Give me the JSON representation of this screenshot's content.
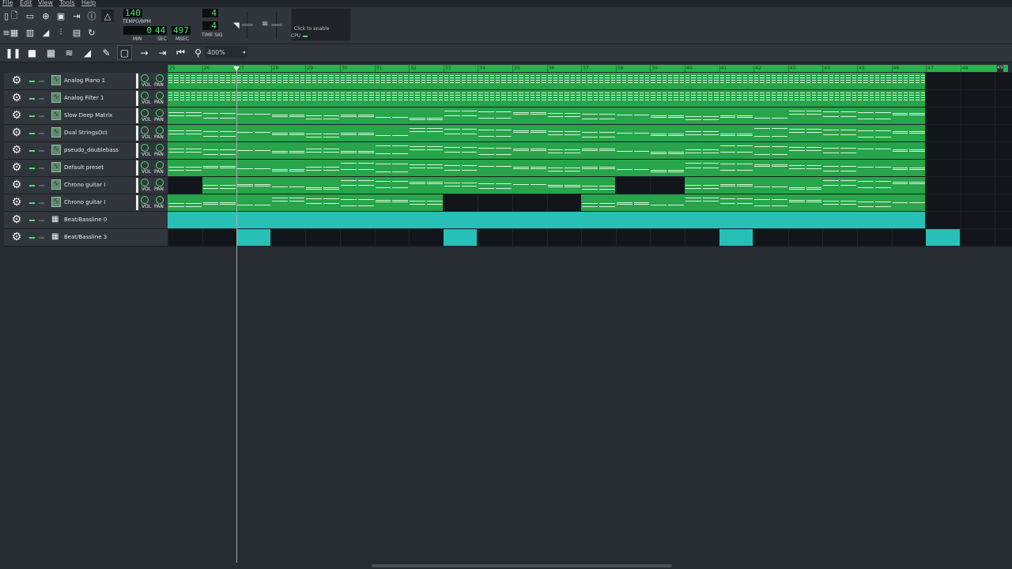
{
  "menu": [
    "File",
    "Edit",
    "View",
    "Tools",
    "Help"
  ],
  "transport": {
    "tempo": "140",
    "tempo_label": "TEMPO/BPM",
    "time_min": "0",
    "time_sec": "44",
    "time_msec": "497",
    "min_label": "MIN",
    "sec_label": "SEC",
    "msec_label": "MSEC",
    "timesig_num": "4",
    "timesig_den": "4",
    "timesig_label": "TIME SIG"
  },
  "cpu": {
    "hint": "Click to enable",
    "label": "CPU"
  },
  "editor": {
    "zoom": "400%"
  },
  "ruler": {
    "bars": [
      "25",
      "26",
      "27",
      "28",
      "29",
      "30",
      "31",
      "32",
      "33",
      "34",
      "35",
      "36",
      "37",
      "38",
      "39",
      "40",
      "41",
      "42",
      "43",
      "44",
      "45",
      "46",
      "47",
      "48"
    ],
    "end_label": "49"
  },
  "tracks": [
    {
      "name": "Analog Piano 1",
      "type": "instrument"
    },
    {
      "name": "Analog Filter 1",
      "type": "instrument"
    },
    {
      "name": "Slow Deep Matrix",
      "type": "instrument"
    },
    {
      "name": "Dual StringsOct",
      "type": "instrument"
    },
    {
      "name": "pseudo_doublebass",
      "type": "instrument"
    },
    {
      "name": "Default preset",
      "type": "instrument"
    },
    {
      "name": "Chrono guitar I",
      "type": "instrument"
    },
    {
      "name": "Chrono guitar I",
      "type": "instrument"
    },
    {
      "name": "Beat/Bassline 0",
      "type": "beat"
    },
    {
      "name": "Beat/Bassline 3",
      "type": "beat"
    }
  ],
  "knob_labels": {
    "vol": "VOL",
    "pan": "PAN"
  },
  "colors": {
    "clip_green": "#28a44a",
    "clip_cyan": "#28c0b6",
    "lcd_green": "#4fe06e",
    "background": "#262b32"
  }
}
